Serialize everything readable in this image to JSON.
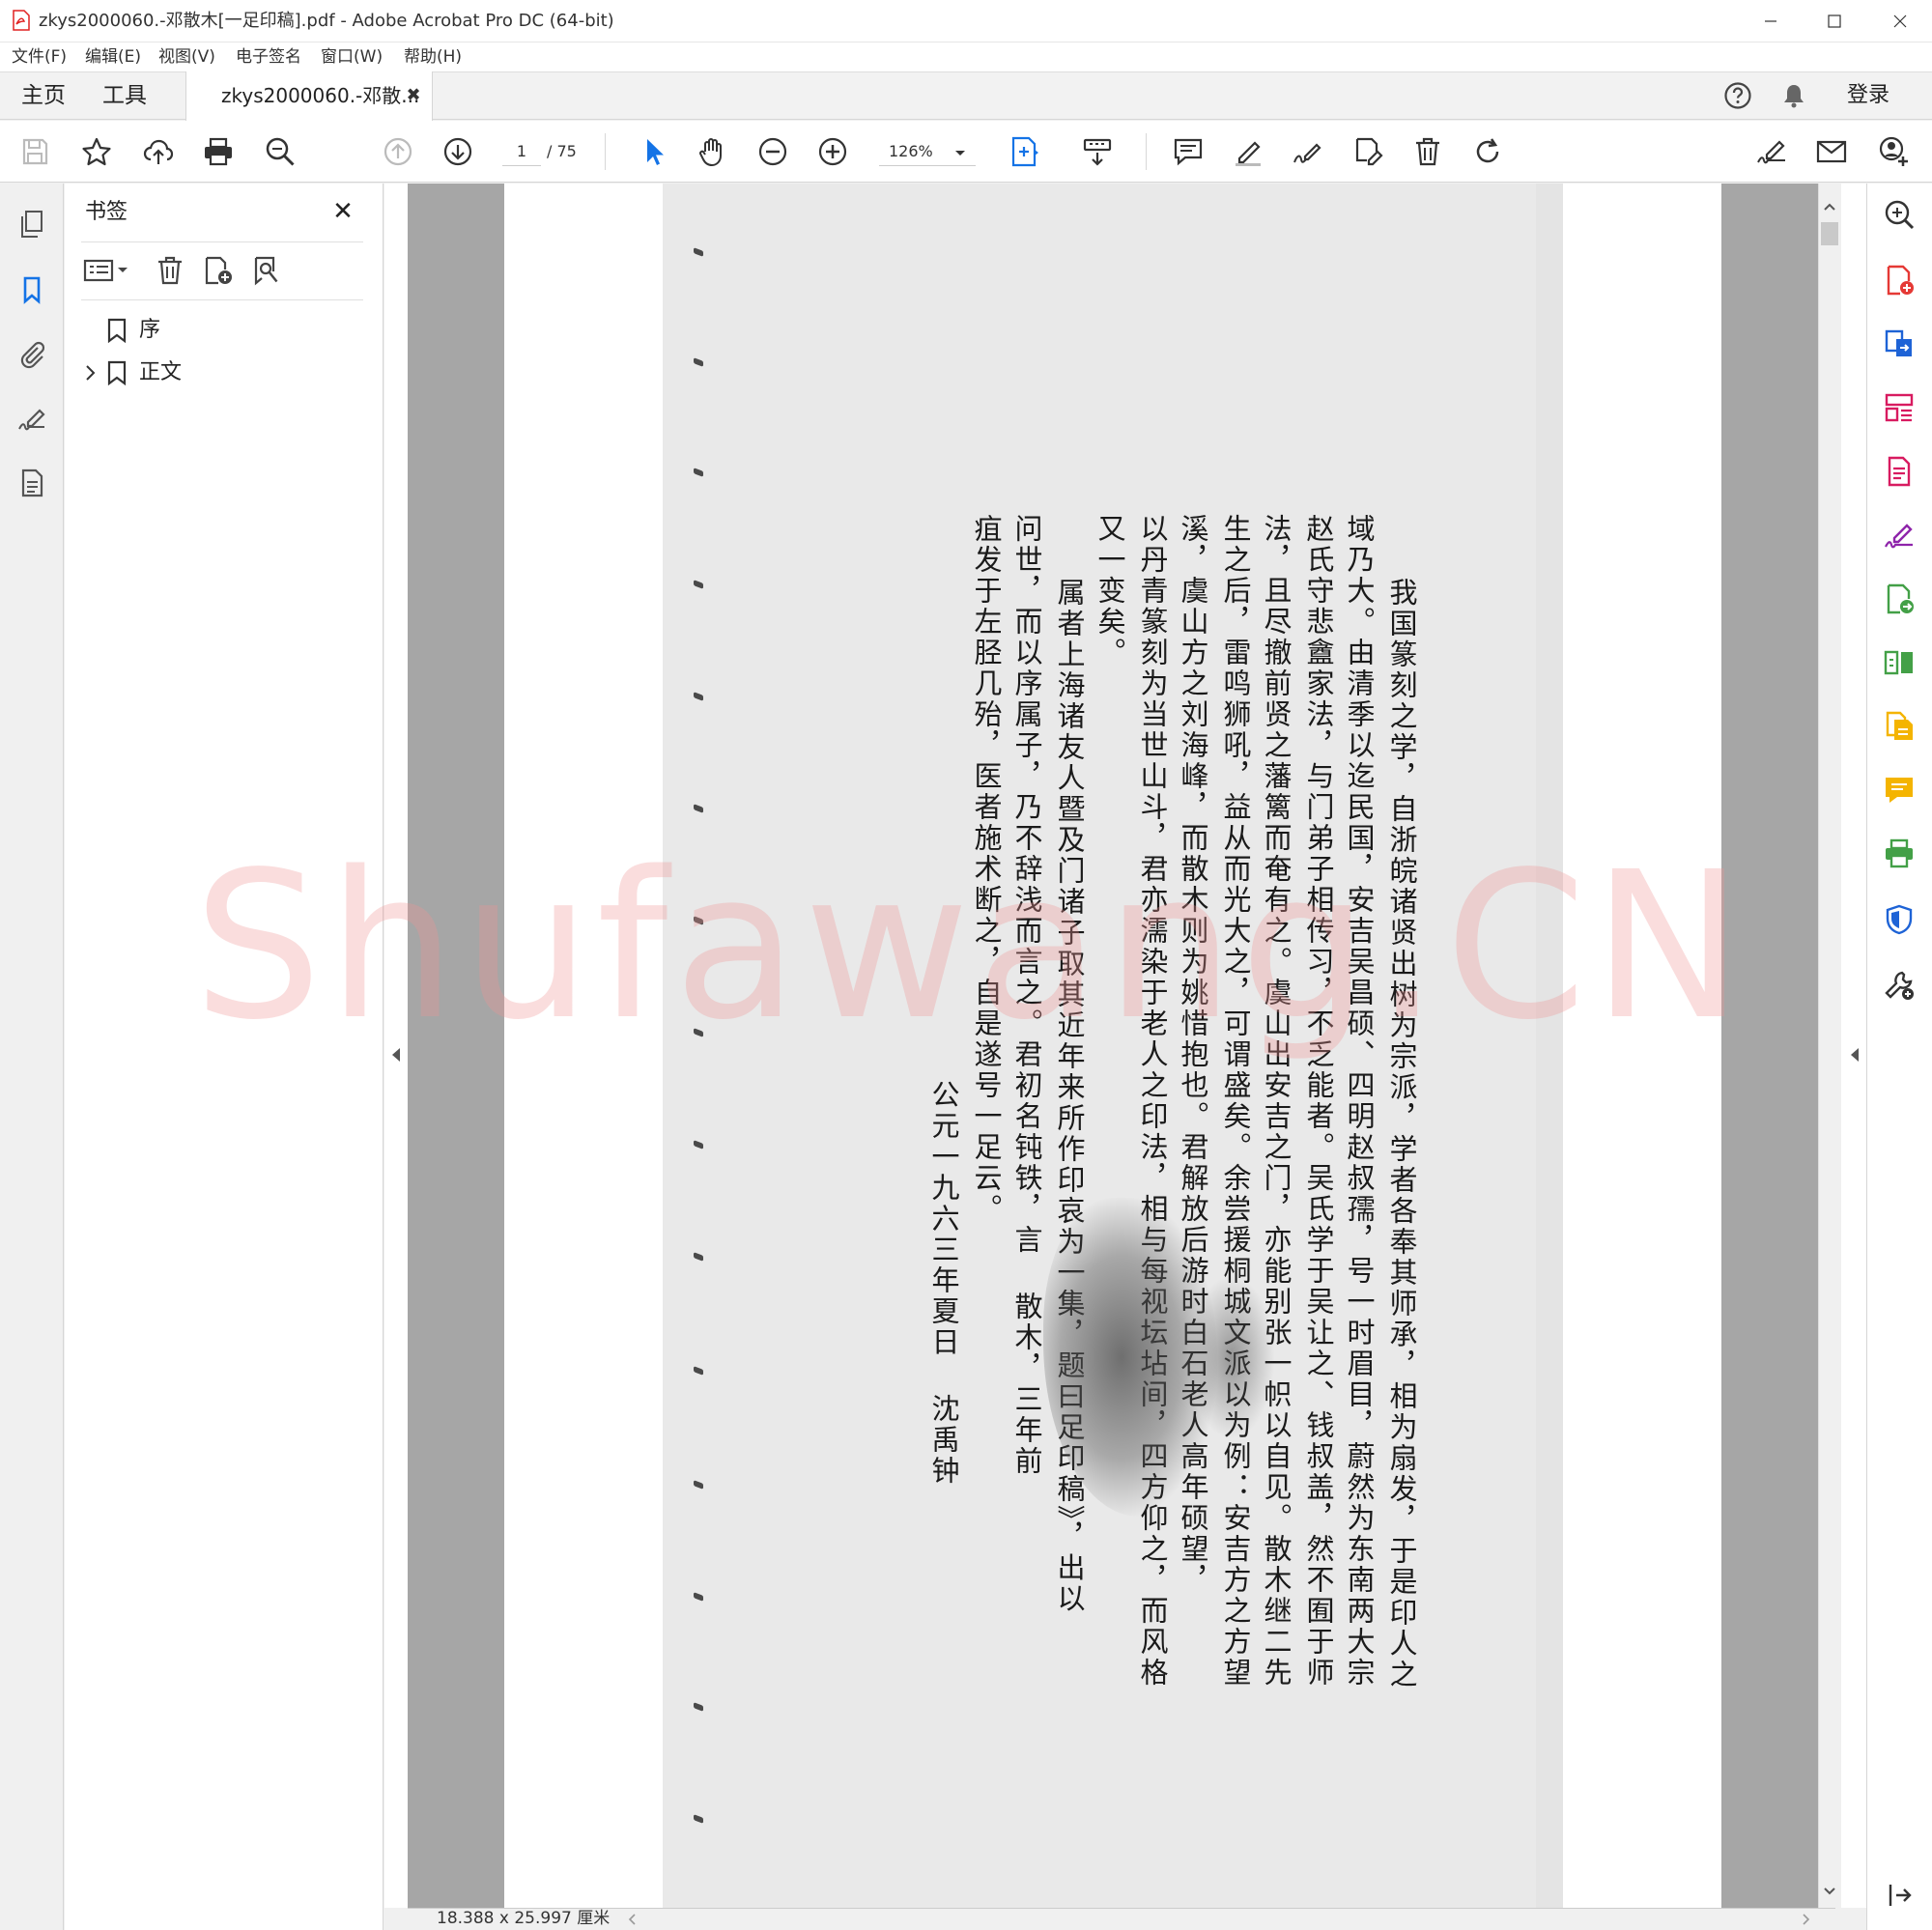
{
  "window": {
    "title": "zkys2000060.-邓散木[一足印稿].pdf - Adobe Acrobat Pro DC (64-bit)",
    "controls": [
      "minimize",
      "maximize",
      "close"
    ]
  },
  "menubar": [
    "文件(F)",
    "编辑(E)",
    "视图(V)",
    "电子签名",
    "窗口(W)",
    "帮助(H)"
  ],
  "nav": {
    "home": "主页",
    "tools": "工具",
    "document_tab": "zkys2000060.-邓散...",
    "sign_in": "登录"
  },
  "toolbar": {
    "current_page": "1",
    "total_pages": "/ 75",
    "zoom": "126%"
  },
  "bookmarks": {
    "title": "书签",
    "items": [
      {
        "label": "序",
        "expandable": false
      },
      {
        "label": "正文",
        "expandable": true
      }
    ]
  },
  "document": {
    "columns": [
      "我国篆刻之学，自浙皖诸贤出树为宗派，学者各奉其师承，相为扇发，于是印人之",
      "域乃大。由清季以迄民国，安吉吴昌硕、四明赵叔孺，号一时眉目，蔚然为东南两大宗",
      "赵氏守悲盦家法，与门弟子相传习，不乏能者。吴氏学于吴让之、钱叔盖，然不囿于师",
      "法，且尽撤前贤之藩篱而奄有之。虞山出安吉之门，亦能别张一帜以自见。散木继二先",
      "生之后，雷鸣狮吼，益从而光大之，可谓盛矣。余尝援桐城文派以为例：安吉方之方望",
      "溪，虞山方之刘海峰，而散木则为姚惜抱也。君解放后游时白石老人高年硕望，",
      "以丹青篆刻为当世山斗，君亦濡染于老人之印法，相与每视坛坫间，四方仰之，而风格",
      "又一变矣。",
      "属者上海诸友人暨及门诸子取其近年来所作印哀为一集，题曰足印稿》，出以",
      "问世，而以序属子，乃不辞浅而言之。君初名钝铁，言    散木，三年前",
      "疽发于左胫几殆，医者施术断之，自是遂号一足云。",
      "公元一九六三年夏日    沈禹钟"
    ],
    "page_size": "18.388 x 25.997 厘米"
  },
  "watermark": "Shufawang.CN",
  "colors": {
    "accent_blue": "#1473e6",
    "pdf_red": "#e02020",
    "watermark": "#f09696",
    "rail_red": "#e53935",
    "rail_purple": "#8e24aa",
    "rail_green": "#43a047",
    "rail_yellow": "#f4b400",
    "rail_pink": "#d81b60",
    "rail_blue": "#1e63d6"
  }
}
